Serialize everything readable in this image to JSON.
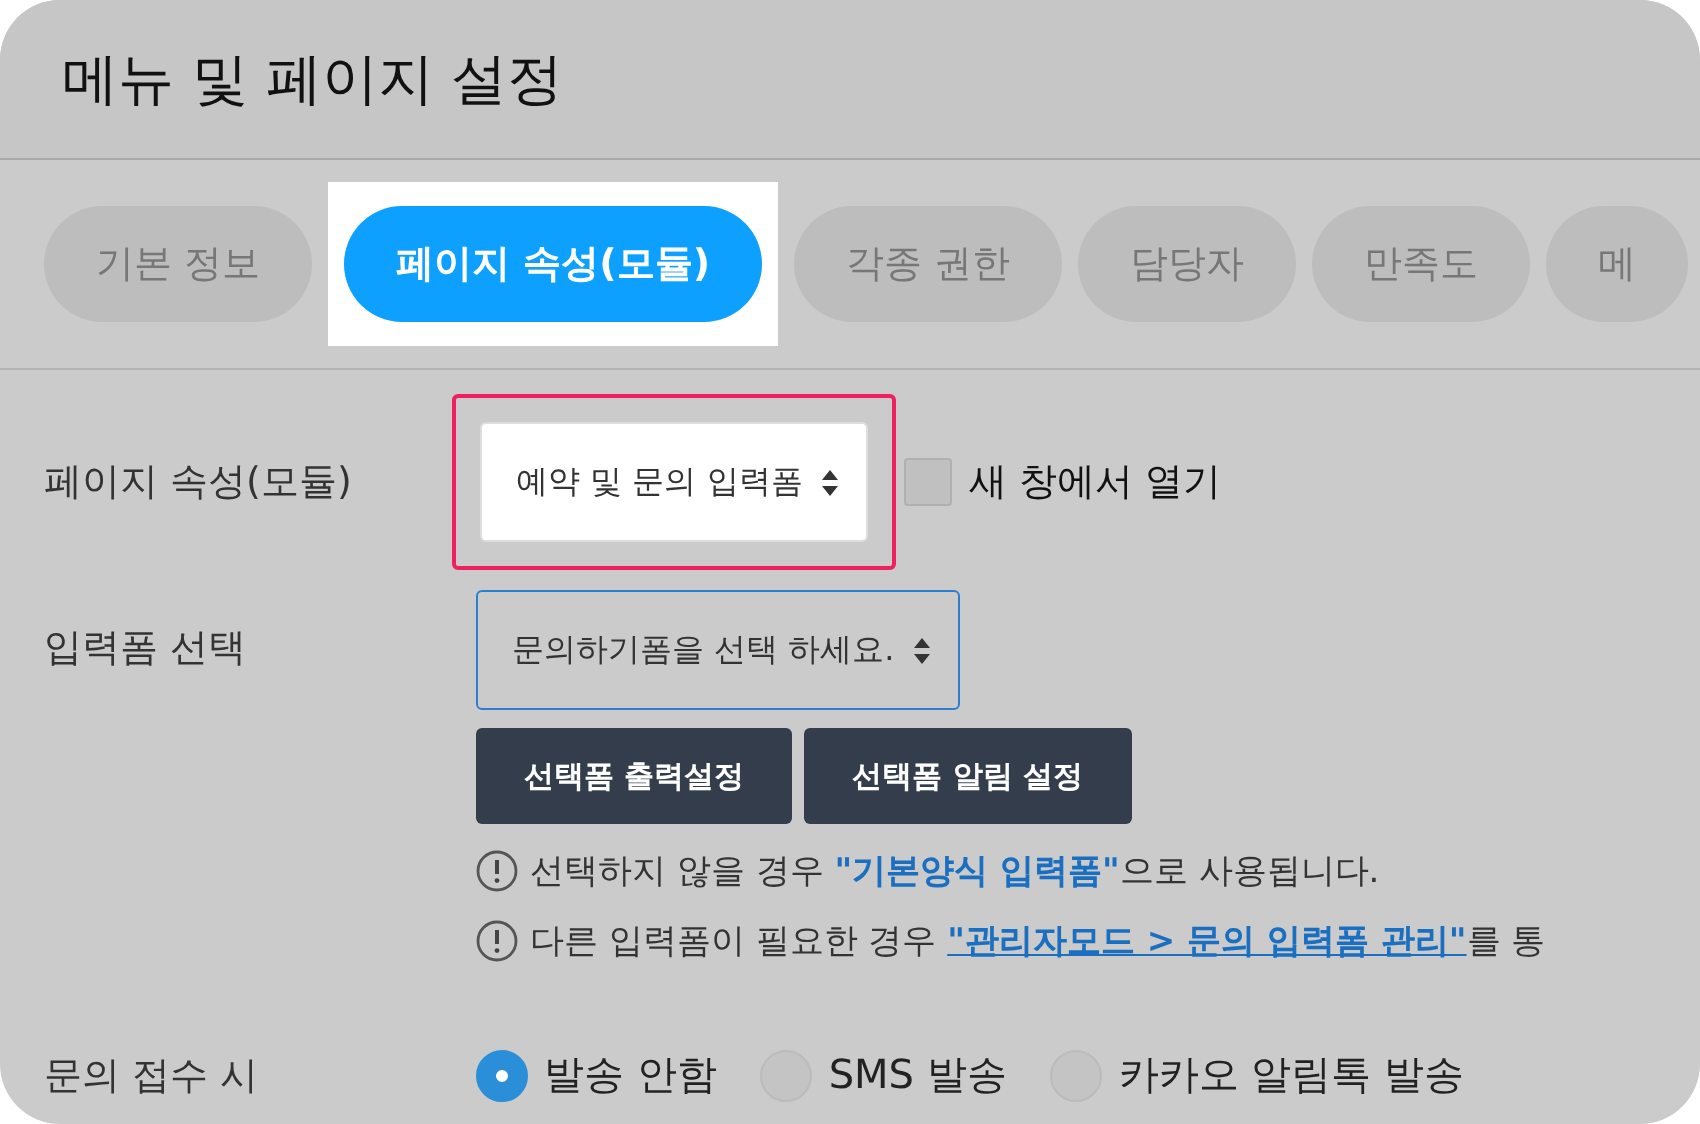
{
  "window": {
    "title": "메뉴 및 페이지 설정"
  },
  "tabs": [
    {
      "label": "기본 정보",
      "selected": false
    },
    {
      "label": "페이지 속성(모듈)",
      "selected": true
    },
    {
      "label": "각종 권한",
      "selected": false
    },
    {
      "label": "담당자",
      "selected": false
    },
    {
      "label": "만족도",
      "selected": false
    },
    {
      "label": "메",
      "selected": false
    }
  ],
  "module_row": {
    "label": "페이지 속성(모듈)",
    "select": {
      "value": "예약 및 문의 입력폼",
      "highlighted": true
    },
    "new_window": {
      "label": "새 창에서 열기",
      "checked": false
    }
  },
  "form_row": {
    "label": "입력폼 선택",
    "select": {
      "value": "문의하기폼을 선택 하세요.",
      "focused": true
    },
    "buttons": [
      "선택폼 출력설정",
      "선택폼 알림 설정"
    ],
    "notes": [
      {
        "before": "선택하지 않을 경우 ",
        "emphasis": "\"기본양식 입력폼\"",
        "after": "으로 사용됩니다.",
        "kind": "emphasis"
      },
      {
        "before": "다른 입력폼이 필요한 경우 ",
        "link": "\"관리자모드 > 문의 입력폼 관리\"",
        "after": "를 통",
        "kind": "link"
      }
    ]
  },
  "notify_row": {
    "label": "문의 접수 시",
    "options": [
      {
        "label": "발송 안함",
        "selected": true
      },
      {
        "label": "SMS 발송",
        "selected": false
      },
      {
        "label": "카카오 알림톡 발송",
        "selected": false
      }
    ]
  }
}
